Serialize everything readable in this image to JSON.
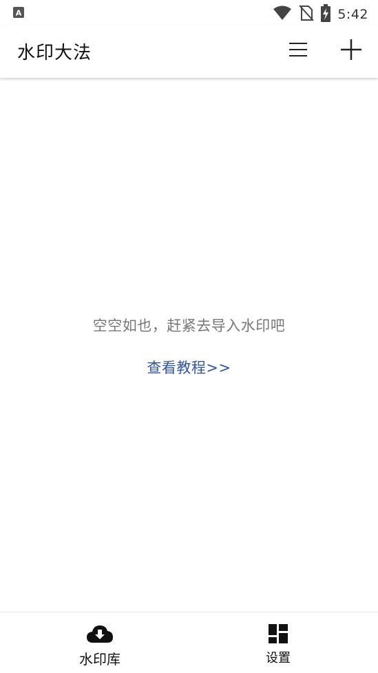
{
  "status_bar": {
    "time": "5:42",
    "icons": [
      "keyboard-a-icon",
      "wifi-icon",
      "no-sim-icon",
      "battery-charging-icon"
    ]
  },
  "app_bar": {
    "title": "水印大法",
    "actions": [
      "menu-icon",
      "add-icon"
    ]
  },
  "main": {
    "empty_message": "空空如也，赶紧去导入水印吧",
    "tutorial_link": "查看教程>>"
  },
  "bottom_nav": {
    "items": [
      {
        "label": "水印库",
        "icon": "cloud-download-icon",
        "selected": true
      },
      {
        "label": "设置",
        "icon": "dashboard-grid-icon",
        "selected": false
      }
    ]
  },
  "colors": {
    "link": "#2f56a7",
    "empty_text": "#777777",
    "icon": "#111111"
  }
}
